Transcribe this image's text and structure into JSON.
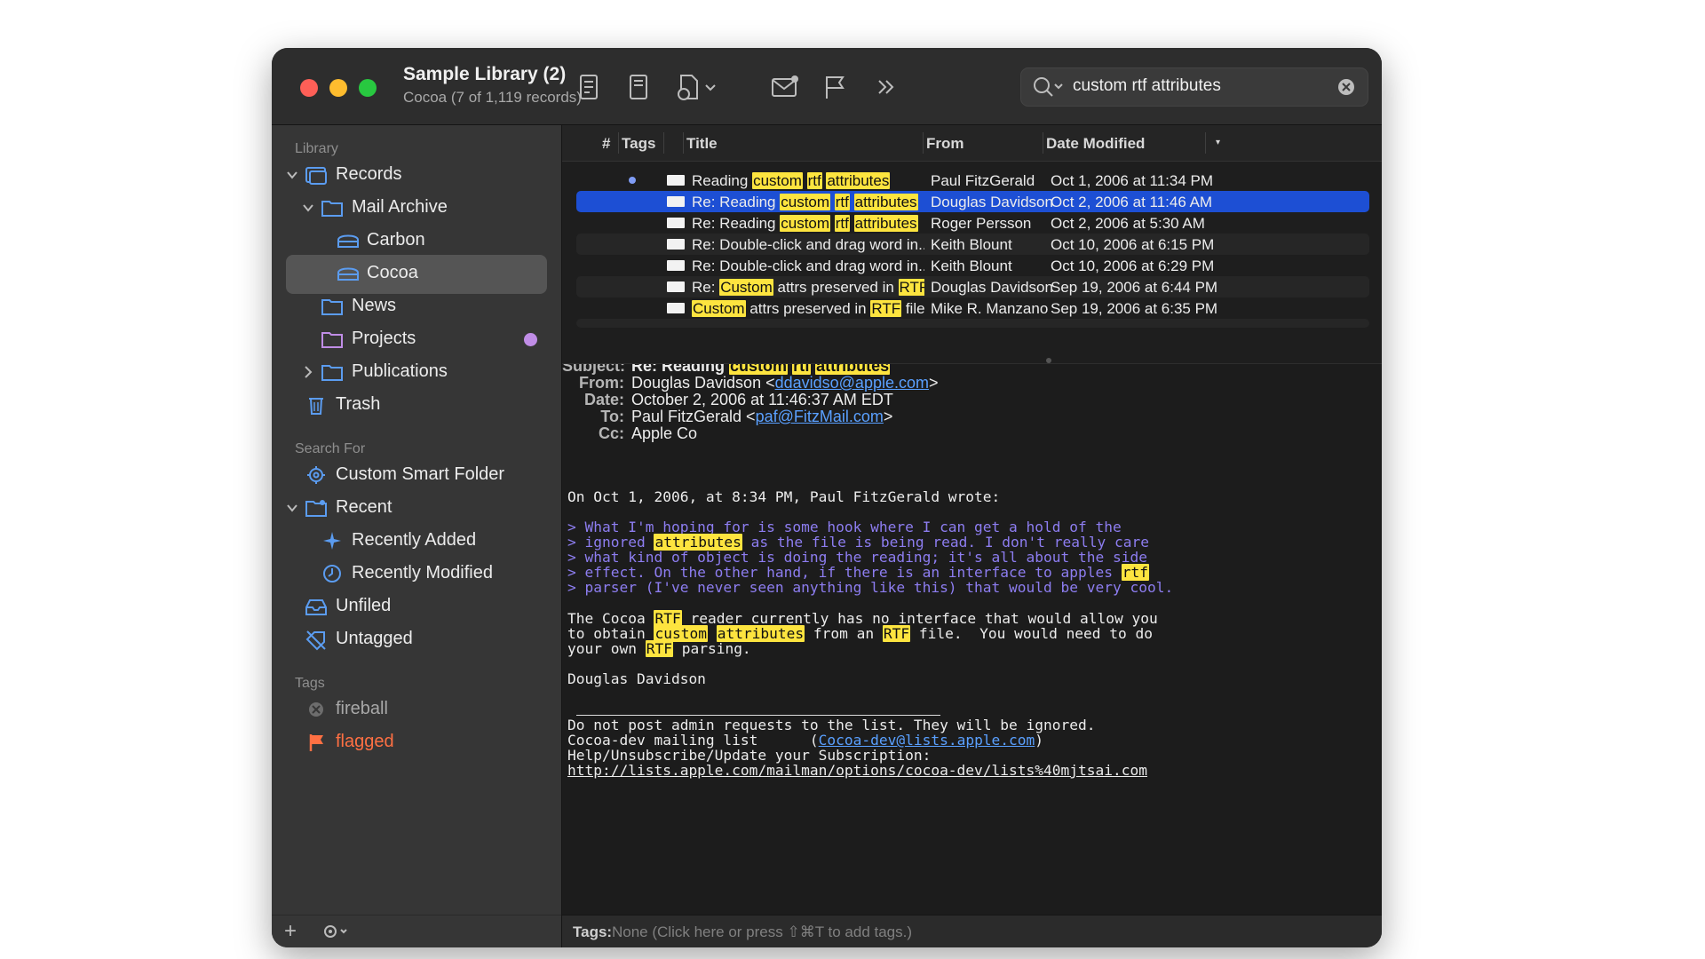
{
  "window": {
    "title": "Sample Library (2)",
    "subtitle": "Cocoa (7 of 1,119 records)"
  },
  "toolbar": {
    "icons": [
      "inspector-icon",
      "document-icon",
      "new-document-icon",
      "chevron-down-icon",
      "mail-icon",
      "flag-icon",
      "more-icon"
    ],
    "search_value": "custom rtf attributes"
  },
  "sidebar": {
    "library_heading": "Library",
    "search_heading": "Search For",
    "tags_heading": "Tags",
    "items": [
      {
        "label": "Records"
      },
      {
        "label": "Mail Archive"
      },
      {
        "label": "Carbon"
      },
      {
        "label": "Cocoa",
        "selected": true
      },
      {
        "label": "News"
      },
      {
        "label": "Projects",
        "badge_color": "#c08de6"
      },
      {
        "label": "Publications"
      },
      {
        "label": "Trash"
      }
    ],
    "search_items": [
      {
        "label": "Custom Smart Folder"
      },
      {
        "label": "Recent"
      },
      {
        "label": "Recently Added"
      },
      {
        "label": "Recently Modified"
      },
      {
        "label": "Unfiled"
      },
      {
        "label": "Untagged"
      }
    ],
    "tags": [
      {
        "label": "fireball",
        "color": "#9a9a9a"
      },
      {
        "label": "flagged",
        "color": "#ff7043"
      }
    ],
    "footer_add": "+"
  },
  "list": {
    "columns": [
      "#",
      "Tags",
      "Title",
      "From",
      "Date Modified"
    ],
    "rows": [
      {
        "title_parts": [
          "Reading ",
          "custom",
          " ",
          "rtf",
          " ",
          "attributes"
        ],
        "from": "Paul FitzGerald",
        "date": "Oct 1, 2006 at 11:34 PM",
        "unread": true
      },
      {
        "title_parts": [
          "Re: Reading ",
          "custom",
          " ",
          "rtf",
          " ",
          "attributes"
        ],
        "from": "Douglas Davidson",
        "date": "Oct 2, 2006 at 11:46 AM",
        "selected": true
      },
      {
        "title_parts": [
          "Re: Reading ",
          "custom",
          " ",
          "rtf",
          " ",
          "attributes"
        ],
        "from": "Roger Persson",
        "date": "Oct 2, 2006 at 5:30 AM"
      },
      {
        "title_parts": [
          "Re: Double-click and drag word in..."
        ],
        "from": "Keith Blount",
        "date": "Oct 10, 2006 at 6:15 PM"
      },
      {
        "title_parts": [
          "Re: Double-click and drag word in..."
        ],
        "from": "Keith Blount",
        "date": "Oct 10, 2006 at 6:29 PM"
      },
      {
        "title_parts": [
          "Re: ",
          "Custom",
          " attrs preserved in ",
          "RTF",
          " f..."
        ],
        "from": "Douglas Davidson",
        "date": "Sep 19, 2006 at 6:44 PM"
      },
      {
        "title_parts": [
          "",
          "Custom",
          " attrs preserved in ",
          "RTF",
          " files?"
        ],
        "from": "Mike R. Manzano",
        "date": "Sep 19, 2006 at 6:35 PM"
      }
    ]
  },
  "message": {
    "labels": {
      "subject": "Subject:",
      "from": "From:",
      "date": "Date:",
      "to": "To:",
      "cc": "Cc:"
    },
    "subject_prefix": "Re: Reading",
    "subject_hl": [
      "custom",
      "rtf",
      "attributes"
    ],
    "from_name": "Douglas Davidson <",
    "from_email": "ddavidso@apple.com",
    "from_close": ">",
    "date": "October 2, 2006 at 11:46:37 AM EDT",
    "to_name": "Paul FitzGerald <",
    "to_email": "paf@FitzMail.com",
    "to_close": ">",
    "cc": "Apple Co",
    "intro": "On Oct 1, 2006, at 8:34 PM, Paul FitzGerald wrote:",
    "quote_1": "> What I'm hoping for is some hook where I can get a hold of the",
    "quote_2a": "> ignored ",
    "quote_2b": "attributes",
    "quote_2c": " as the file is being read. I don't really care",
    "quote_3": "> what kind of object is doing the reading; it's all about the side",
    "quote_4a": "> effect. On the other hand, if there is an interface to apples ",
    "quote_4b": "rtf",
    "quote_5": "> parser (I've never seen anything like this) that would be very cool.",
    "body_1a": "The Cocoa ",
    "body_1b": "RTF",
    "body_1c": " reader currently has no interface that would allow you",
    "body_2a": "to obtain ",
    "body_2b": "custom",
    "body_2c": " ",
    "body_2d": "attributes",
    "body_2e": " from an ",
    "body_2f": "RTF",
    "body_2g": " file.  You would need to do",
    "body_3a": "your own ",
    "body_3b": "RTF",
    "body_3c": " parsing.",
    "signature": "Douglas Davidson",
    "footer_1": "Do not post admin requests to the list. They will be ignored.",
    "footer_2a": "Cocoa-dev mailing list      (",
    "footer_2b": "Cocoa-dev@lists.apple.com",
    "footer_2c": ")",
    "footer_3": "Help/Unsubscribe/Update your Subscription:",
    "footer_4": "http://lists.apple.com/mailman/options/cocoa-dev/lists%40mjtsai.com"
  },
  "tagbar": {
    "label": "Tags:",
    "hint": "None (Click here or press ⇧⌘T to add tags.)"
  },
  "colors": {
    "selection": "#1d4fd4",
    "highlight": "#fde43f",
    "quote": "#8d7df0",
    "link": "#5aa0ff",
    "folder_icon": "#5b9cf0"
  }
}
